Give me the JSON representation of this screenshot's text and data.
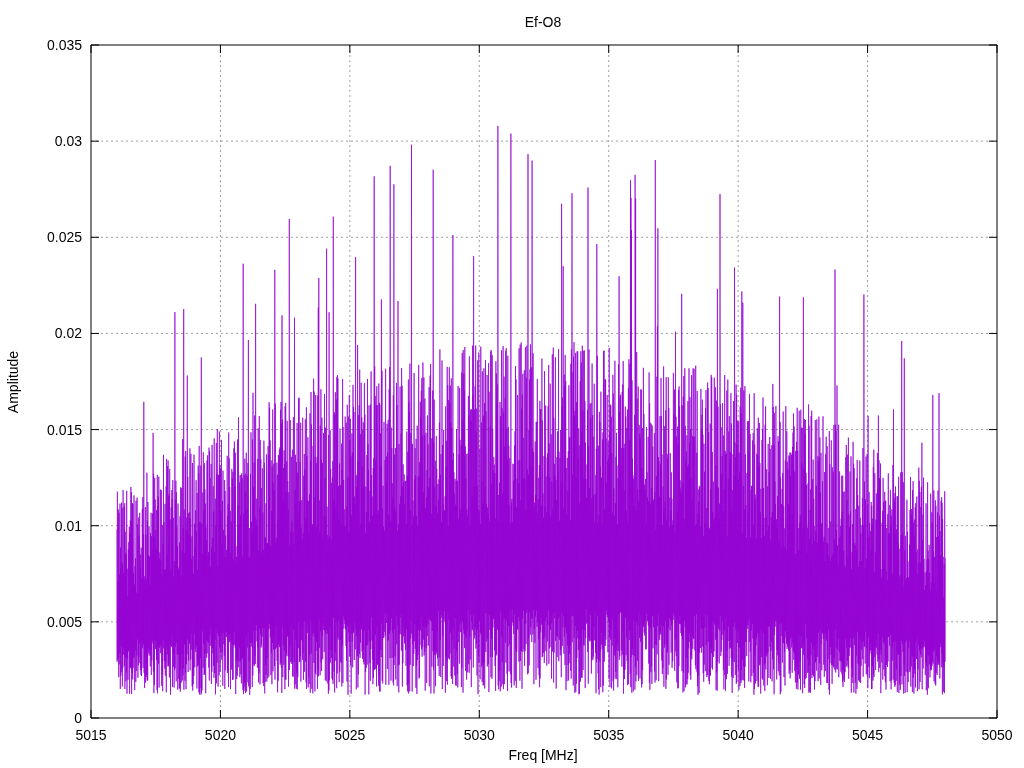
{
  "chart": {
    "title": "Ef-O8",
    "xlabel": "Freq [MHz]",
    "ylabel": "Amplitude",
    "xticks": [
      "5015",
      "5020",
      "5025",
      "5030",
      "5035",
      "5040",
      "5045",
      "5050"
    ],
    "yticks": [
      "0.035",
      "0.03",
      "0.025",
      "0.02",
      "0.015",
      "0.01",
      "0.005",
      "0"
    ]
  }
}
